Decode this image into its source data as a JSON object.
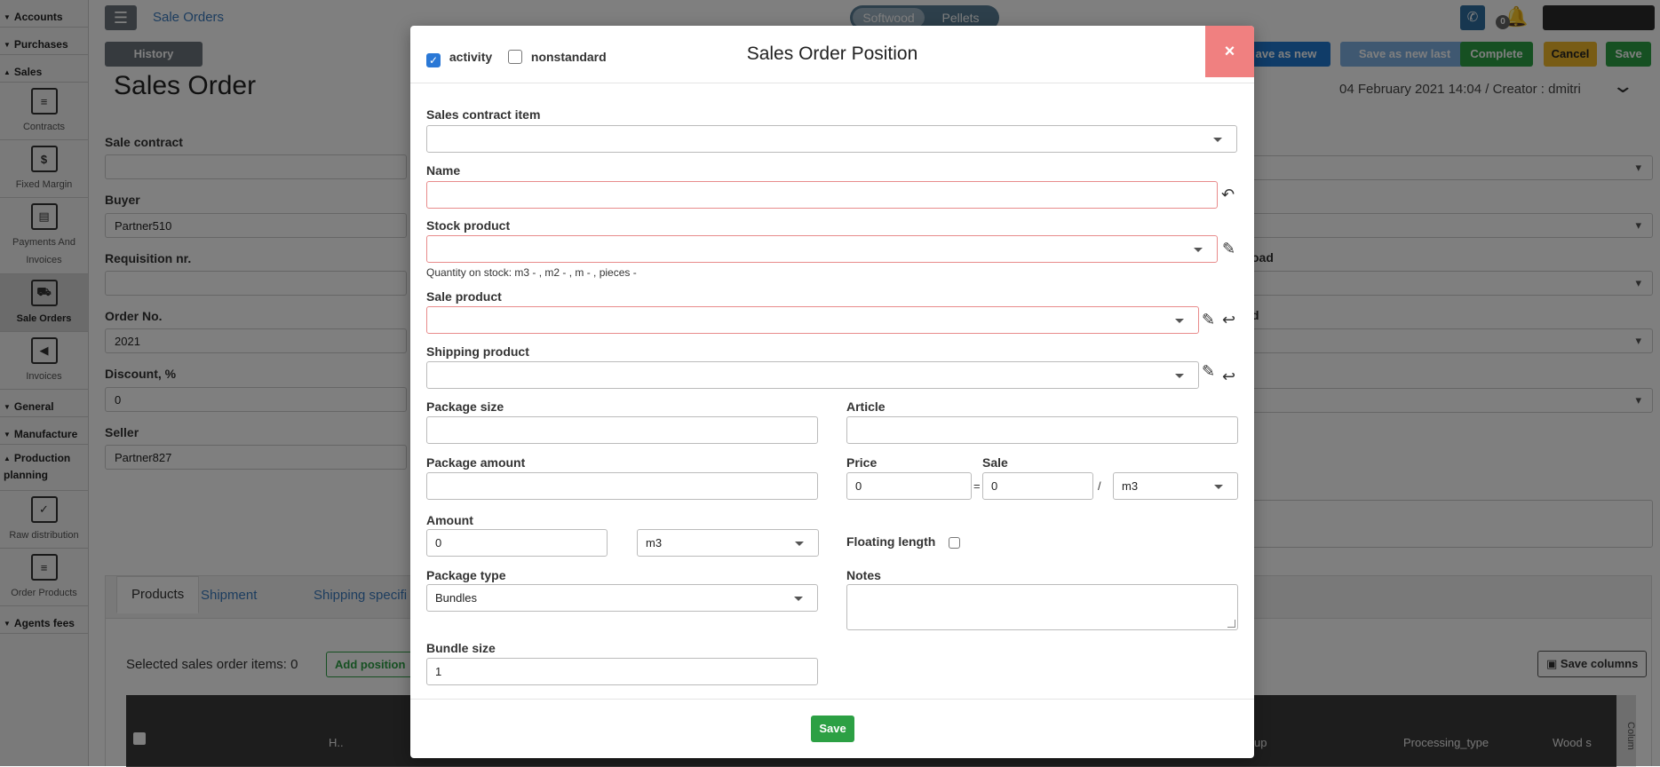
{
  "sidebar": {
    "sections": [
      {
        "label": "Accounts",
        "expanded": false
      },
      {
        "label": "Purchases",
        "expanded": false
      },
      {
        "label": "Sales",
        "expanded": true
      }
    ],
    "sales_items": [
      {
        "label": "Contracts",
        "icon": "document-icon"
      },
      {
        "label": "Fixed Margin",
        "icon": "dollar-icon"
      },
      {
        "label": "Payments And Invoices",
        "icon": "invoice-icon"
      },
      {
        "label": "Sale Orders",
        "icon": "cart-icon",
        "active": true
      },
      {
        "label": "Invoices",
        "icon": "invoice-back-icon"
      }
    ],
    "general": "General",
    "manufacture": "Manufacture",
    "production_planning": "Production planning",
    "production_items": [
      {
        "label": "Raw distribution",
        "icon": "checklist-icon"
      },
      {
        "label": "Order Products",
        "icon": "document-icon"
      }
    ],
    "agents_fees": "Agents fees"
  },
  "topbar": {
    "breadcrumb": "Sale Orders",
    "toggle": [
      "Softwood",
      "Pellets"
    ],
    "notification_count": "0"
  },
  "actions": {
    "history": "History",
    "save_as_new": "ave as new",
    "save_as_new_last": "Save as new last",
    "complete": "Complete",
    "cancel": "Cancel",
    "save": "Save"
  },
  "order": {
    "title": "Sales Order",
    "meta": "04 February 2021 14:04 / Creator : dmitri",
    "fields": [
      {
        "label": "Sale contract",
        "value": ""
      },
      {
        "label": "Buyer",
        "value": "Partner510"
      },
      {
        "label": "Requisition nr.",
        "value": ""
      },
      {
        "label": "Order No.",
        "value": "2021"
      },
      {
        "label": "Discount, %",
        "value": "0"
      },
      {
        "label": "Seller",
        "value": "Partner827"
      }
    ],
    "right_labels": [
      "oad",
      "d"
    ]
  },
  "tabs": {
    "items": [
      "Products",
      "Shipment",
      "Shipping specifi"
    ],
    "selected_count": "Selected sales order items: 0",
    "add_position": "Add position",
    "save_columns": "Save columns",
    "grid_headers": [
      "H..",
      "up",
      "Processing_type",
      "Wood s",
      "Colum"
    ]
  },
  "modal": {
    "title": "Sales Order Position",
    "activity_label": "activity",
    "activity_checked": true,
    "nonstandard_label": "nonstandard",
    "nonstandard_checked": false,
    "close_glyph": "×",
    "sales_contract_item": {
      "label": "Sales contract item",
      "value": ""
    },
    "name": {
      "label": "Name",
      "value": ""
    },
    "stock_product": {
      "label": "Stock product",
      "value": "",
      "hint": "Quantity on stock: m3 - , m2 - , m - , pieces -"
    },
    "sale_product": {
      "label": "Sale product",
      "value": ""
    },
    "shipping_product": {
      "label": "Shipping product",
      "value": ""
    },
    "package_size": {
      "label": "Package size",
      "value": ""
    },
    "article": {
      "label": "Article",
      "value": ""
    },
    "package_amount": {
      "label": "Package amount",
      "value": ""
    },
    "price": {
      "label": "Price",
      "value": "0"
    },
    "equals": "=",
    "sale": {
      "label": "Sale",
      "value": "0"
    },
    "slash": "/",
    "price_unit": "m3",
    "amount": {
      "label": "Amount",
      "value": "0",
      "unit": "m3"
    },
    "floating_length": {
      "label": "Floating length",
      "checked": false
    },
    "package_type": {
      "label": "Package type",
      "value": "Bundles"
    },
    "notes": {
      "label": "Notes",
      "value": ""
    },
    "bundle_size": {
      "label": "Bundle size",
      "value": "1"
    },
    "save": "Save"
  },
  "colors": {
    "primary": "#2079d0",
    "success": "#2ca044",
    "warning": "#f0b92a",
    "danger_close": "#f08080",
    "required_border": "#e88b8b"
  }
}
